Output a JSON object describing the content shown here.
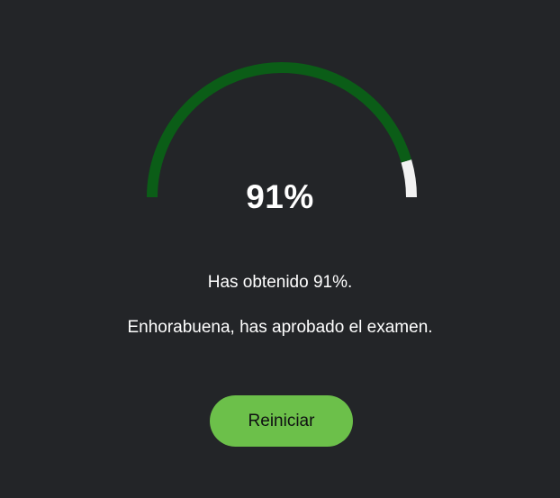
{
  "result": {
    "score_text": "91%",
    "score_fraction": 0.91,
    "obtained_message": "Has obtenido 91%.",
    "pass_message": "Enhorabuena, has aprobado el examen."
  },
  "actions": {
    "restart_label": "Reiniciar"
  },
  "colors": {
    "background": "#232528",
    "gauge_progress": "#0b5d17",
    "gauge_remaining": "#f2f2f2",
    "button": "#6cc04a",
    "button_text": "#0f1012",
    "text": "#ffffff"
  }
}
